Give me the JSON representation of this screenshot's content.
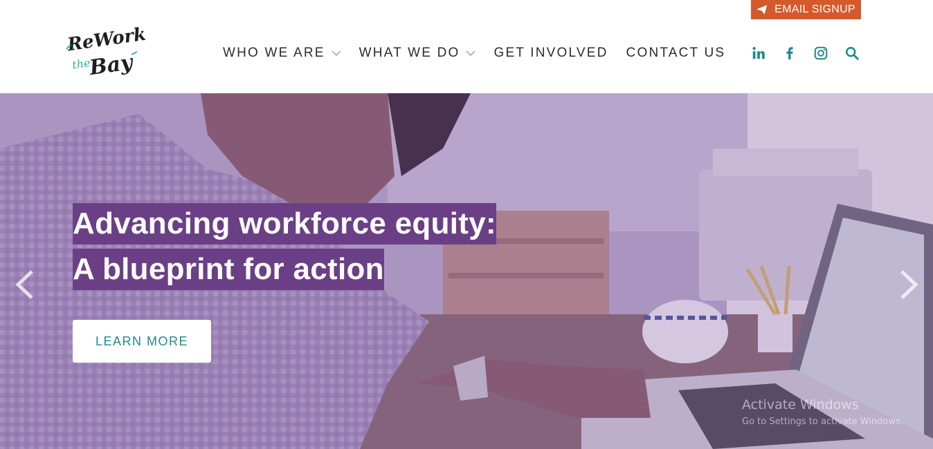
{
  "header": {
    "email_signup_label": "EMAIL SIGNUP",
    "logo_text": "ReWork the Bay",
    "nav": [
      {
        "label": "WHO WE ARE",
        "has_dropdown": true
      },
      {
        "label": "WHAT WE DO",
        "has_dropdown": true
      },
      {
        "label": "GET INVOLVED",
        "has_dropdown": false
      },
      {
        "label": "CONTACT US",
        "has_dropdown": false
      }
    ],
    "social_icons": [
      "linkedin-icon",
      "facebook-icon",
      "instagram-icon",
      "search-icon"
    ]
  },
  "hero": {
    "headline_line1": "Advancing workforce equity:",
    "headline_line2": "A blueprint for action",
    "cta_label": "LEARN MORE",
    "watermark_line1": "Activate Windows",
    "watermark_line2": "Go to Settings to activate Windows."
  },
  "colors": {
    "accent_teal": "#1e8a8d",
    "signup_orange": "#d45a2b",
    "headline_purple": "#6b3f86"
  }
}
